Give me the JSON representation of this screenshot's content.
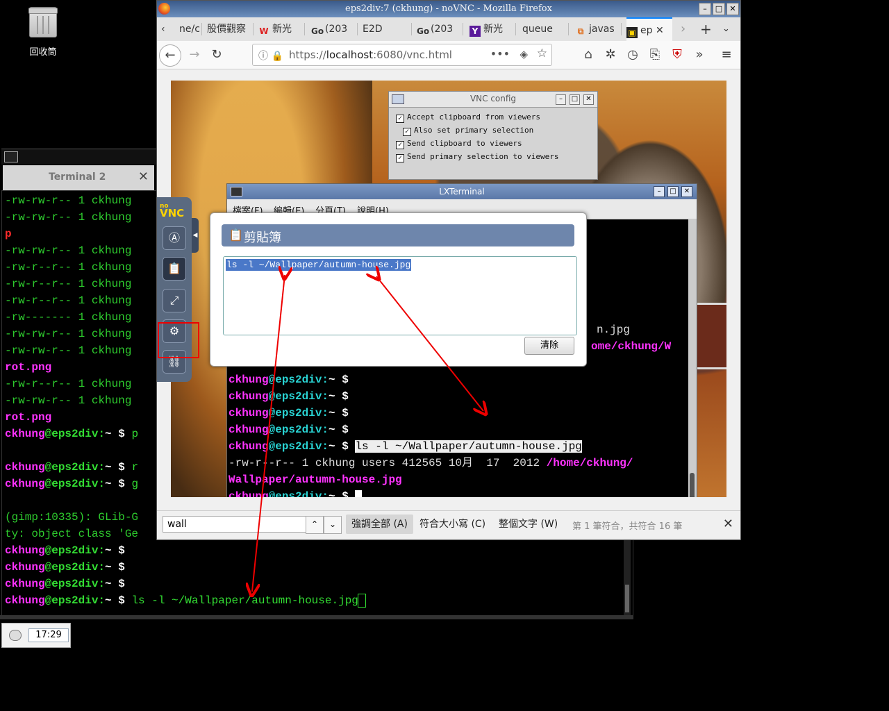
{
  "desktop": {
    "trash_label": "回收筒"
  },
  "term2": {
    "tab_title": "Terminal 2",
    "lines": [
      {
        "a": "-rw-rw-r-- 1 ckhung",
        "c": "g"
      },
      {
        "a": "-rw-rw-r-- 1 ckhung",
        "c": "g"
      },
      {
        "a": "p",
        "c": "r"
      },
      {
        "a": "-rw-rw-r-- 1 ckhung",
        "c": "g"
      },
      {
        "a": "-rw-r--r-- 1 ckhung",
        "c": "g"
      },
      {
        "a": "-rw-r--r-- 1 ckhung",
        "c": "g"
      },
      {
        "a": "-rw-r--r-- 1 ckhung",
        "c": "g"
      },
      {
        "a": "-rw------- 1 ckhung",
        "c": "g"
      },
      {
        "a": "-rw-rw-r-- 1 ckhung",
        "c": "g"
      },
      {
        "a": "-rw-rw-r-- 1 ckhung",
        "c": "g"
      },
      {
        "a": "rot.png",
        "c": "m"
      },
      {
        "a": "-rw-r--r-- 1 ckhung",
        "c": "g"
      },
      {
        "a": "-rw-rw-r-- 1 ckhung",
        "c": "g"
      },
      {
        "a": "rot.png",
        "c": "m"
      },
      {
        "a": "p",
        "c": "prompt"
      },
      {
        "a": "",
        "c": "g"
      },
      {
        "a": "r",
        "c": "prompt"
      },
      {
        "a": "g",
        "c": "prompt"
      },
      {
        "a": "",
        "c": "g"
      },
      {
        "a": "(gimp:10335): GLib-G",
        "c": "g"
      },
      {
        "a": "ty: object class 'Ge",
        "c": "g"
      },
      {
        "a": "",
        "c": "prompt"
      },
      {
        "a": "",
        "c": "prompt"
      },
      {
        "a": "",
        "c": "prompt"
      },
      {
        "a": "ls -l ~/Wallpaper/autumn-house.jpg",
        "c": "prompt"
      }
    ],
    "prompt_user": "ckhung",
    "prompt_host": "@eps2div:",
    "prompt_tail": "~ $ "
  },
  "tray": {
    "time": "17:29"
  },
  "firefox": {
    "title": "eps2div:7 (ckhung) - noVNC - Mozilla Firefox",
    "tabs": [
      {
        "label": "ne/c",
        "icon": ""
      },
      {
        "label": "股價觀察",
        "icon": ""
      },
      {
        "label": "新光",
        "icon": "w"
      },
      {
        "label": "(203",
        "icon": "Go"
      },
      {
        "label": "E2D",
        "icon": ""
      },
      {
        "label": "(203",
        "icon": "Go"
      },
      {
        "label": "新光",
        "icon": "Y"
      },
      {
        "label": "queue",
        "icon": ""
      },
      {
        "label": "javas",
        "icon": "s"
      },
      {
        "label": "ep",
        "icon": "vnc"
      }
    ],
    "url_prefix": "https://",
    "url_host": "localhost",
    "url_rest": ":6080/vnc.html",
    "find": {
      "query": "wall",
      "highlight_all": "強調全部 (A)",
      "match_case": "符合大小寫 (C)",
      "whole_words": "整個文字 (W)",
      "status": "第 1 筆符合，共符合 16 筆"
    }
  },
  "novnc": {
    "logo_top": "no",
    "logo_bottom": "VNC"
  },
  "vncconfig": {
    "title": "VNC config",
    "options": [
      {
        "label": "Accept clipboard from viewers",
        "checked": true
      },
      {
        "label": "Also set primary selection",
        "checked": true
      },
      {
        "label": "Send clipboard to viewers",
        "checked": true
      },
      {
        "label": "Send primary selection to viewers",
        "checked": true
      }
    ]
  },
  "lxterminal": {
    "title": "LXTerminal",
    "menu": [
      "檔案(F)",
      "編輯(E)",
      "分頁(T)",
      "說明(H)"
    ],
    "tail_1": "n.jpg",
    "tail_2": "ome/ckhung/W",
    "cmd": "ls -l ~/Wallpaper/autumn-house.jpg",
    "out_1": "-rw-r--r-- 1 ckhung users 412565 10月  17  2012 ",
    "out_path_1": "/home/ckhung/",
    "out_path_2": "Wallpaper/autumn-house.jpg",
    "prompt_user": "ckhung",
    "prompt_host": "@eps2div:",
    "prompt_tail": "~ $ "
  },
  "clipboard": {
    "title": "剪貼簿",
    "text": "ls -l ~/Wallpaper/autumn-house.jpg",
    "clear_label": "清除"
  }
}
